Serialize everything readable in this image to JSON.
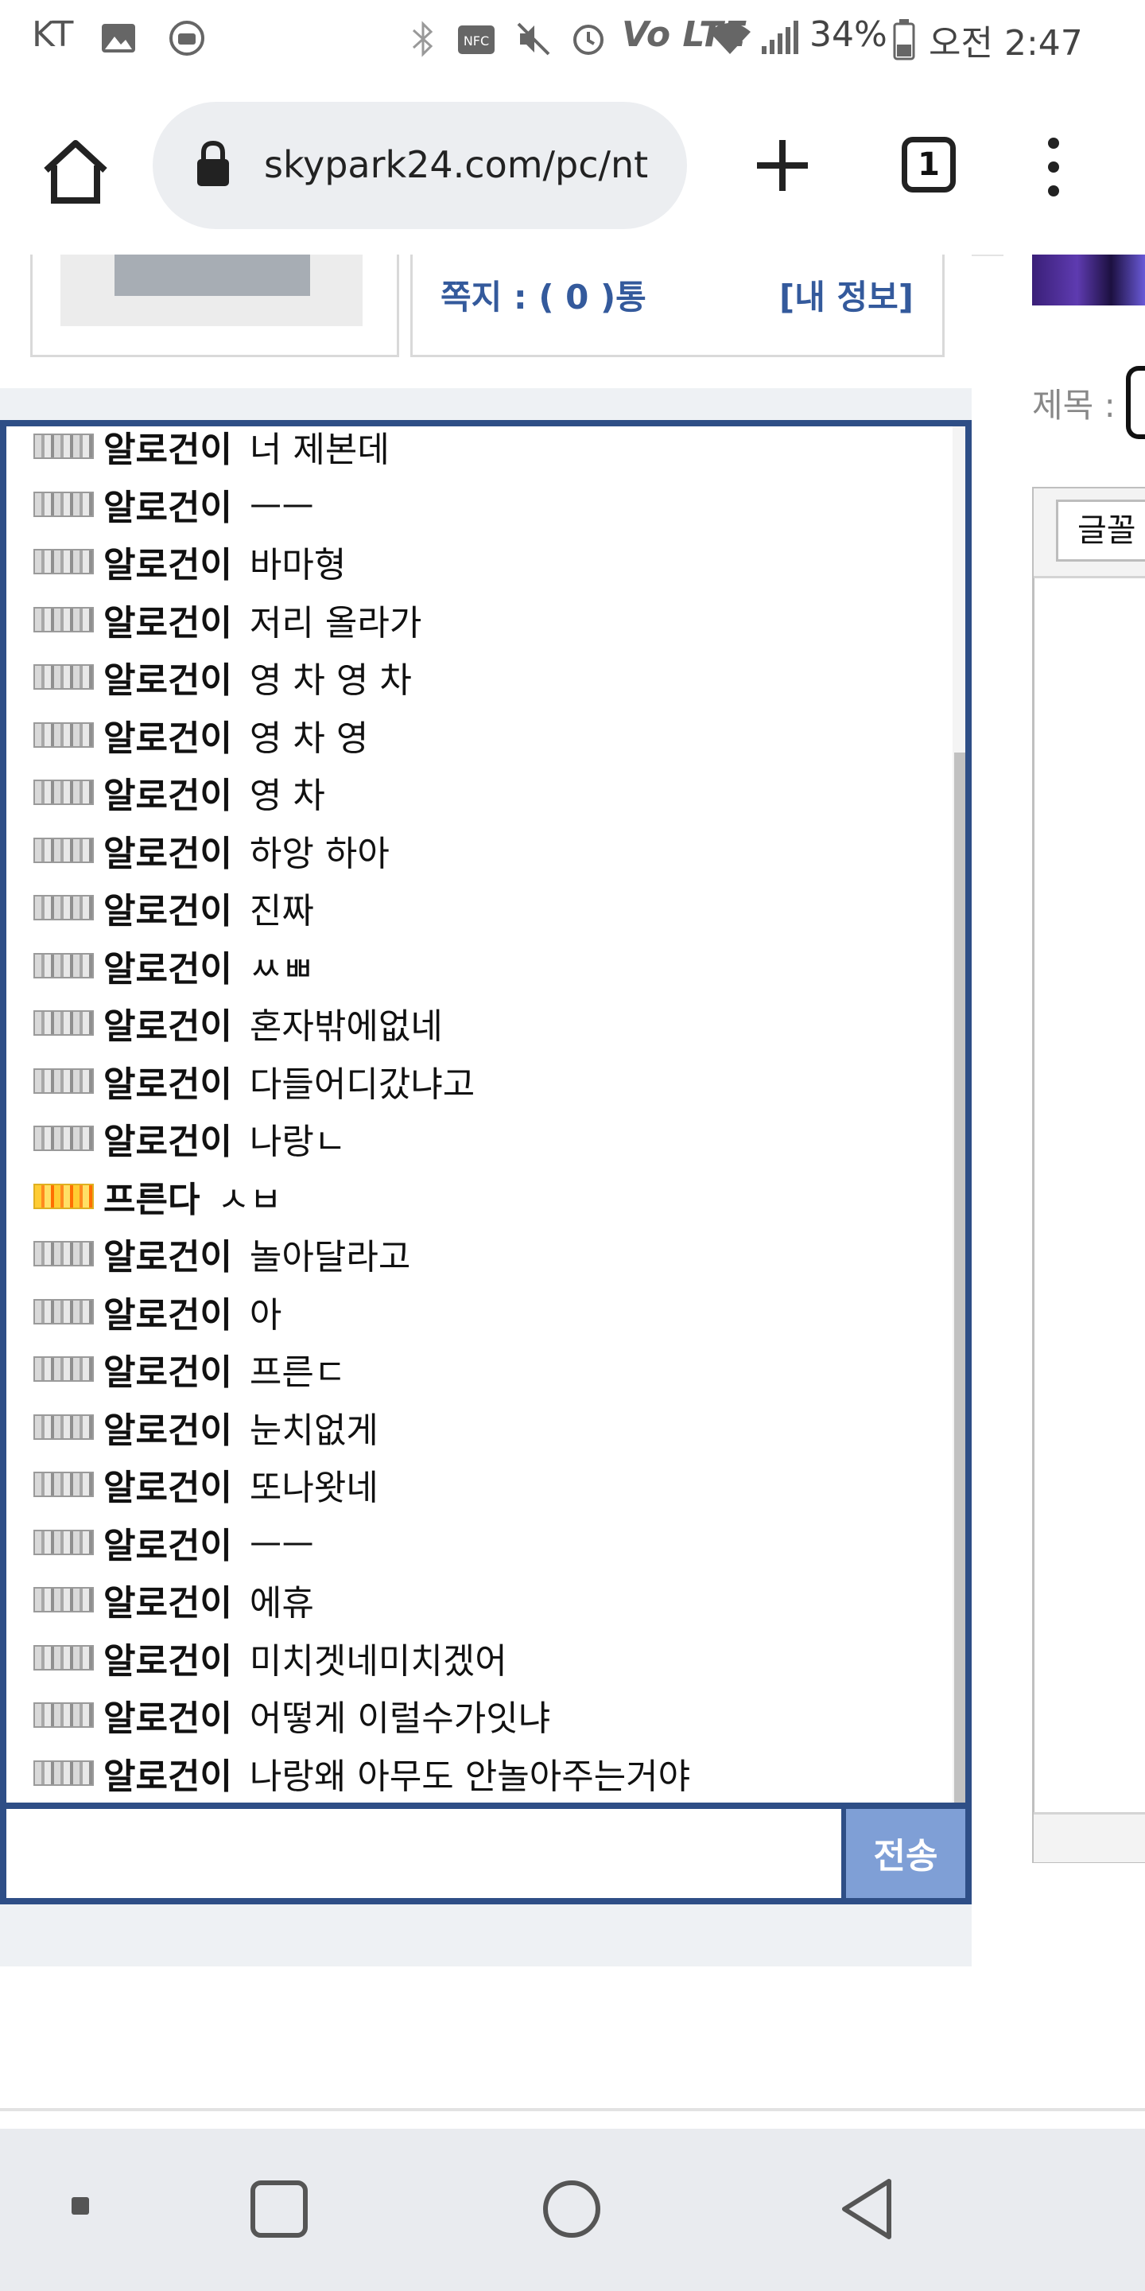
{
  "status_bar": {
    "carrier": "KT",
    "battery": "34%",
    "time": "오전 2:47",
    "network": "Vo LTE"
  },
  "browser": {
    "url": "skypark24.com/pc/nt",
    "tab_count": "1"
  },
  "header": {
    "memo_label": "쪽지 : ( 0 )통",
    "myinfo_label": "[내 정보]"
  },
  "chat": {
    "messages": [
      {
        "nick": "알로건이",
        "text": "너 제본데",
        "level": "silver"
      },
      {
        "nick": "알로건이",
        "text": "ㅡㅡ",
        "level": "silver"
      },
      {
        "nick": "알로건이",
        "text": "바마형",
        "level": "silver"
      },
      {
        "nick": "알로건이",
        "text": "저리 올라가",
        "level": "silver"
      },
      {
        "nick": "알로건이",
        "text": "영 차 영 차",
        "level": "silver"
      },
      {
        "nick": "알로건이",
        "text": "영 차 영",
        "level": "silver"
      },
      {
        "nick": "알로건이",
        "text": "영 차",
        "level": "silver"
      },
      {
        "nick": "알로건이",
        "text": "하앙 하아",
        "level": "silver"
      },
      {
        "nick": "알로건이",
        "text": "진짜",
        "level": "silver"
      },
      {
        "nick": "알로건이",
        "text": "ㅆㅃ",
        "level": "silver"
      },
      {
        "nick": "알로건이",
        "text": "혼자밖에없네",
        "level": "silver"
      },
      {
        "nick": "알로건이",
        "text": "다들어디갔냐고",
        "level": "silver"
      },
      {
        "nick": "알로건이",
        "text": "나랑ㄴ",
        "level": "silver"
      },
      {
        "nick": "프른다",
        "text": "ㅅㅂ",
        "level": "gold"
      },
      {
        "nick": "알로건이",
        "text": "놀아달라고",
        "level": "silver"
      },
      {
        "nick": "알로건이",
        "text": "아",
        "level": "silver"
      },
      {
        "nick": "알로건이",
        "text": "프른ㄷ",
        "level": "silver"
      },
      {
        "nick": "알로건이",
        "text": "눈치없게",
        "level": "silver"
      },
      {
        "nick": "알로건이",
        "text": "또나왓네",
        "level": "silver"
      },
      {
        "nick": "알로건이",
        "text": "ㅡㅡ",
        "level": "silver"
      },
      {
        "nick": "알로건이",
        "text": "에휴",
        "level": "silver"
      },
      {
        "nick": "알로건이",
        "text": "미치겟네미치겠어",
        "level": "silver"
      },
      {
        "nick": "알로건이",
        "text": "어떻게 이럴수가잇냐",
        "level": "silver"
      },
      {
        "nick": "알로건이",
        "text": "나랑왜 아무도 안놀아주는거야",
        "level": "silver"
      }
    ],
    "input_value": "",
    "send_label": "전송"
  },
  "right_panel": {
    "subject_label": "제목 :",
    "font_button_label": "글꼴"
  },
  "colors": {
    "chat_border": "#2e4e86",
    "send_button": "#7f9fd6",
    "link_blue": "#345a9c"
  },
  "icons": [
    "home-icon",
    "lock-icon",
    "plus-icon",
    "tab-switcher-icon",
    "more-vert-icon",
    "level-badge-icon",
    "recents-icon",
    "home-circle-icon",
    "back-icon"
  ]
}
